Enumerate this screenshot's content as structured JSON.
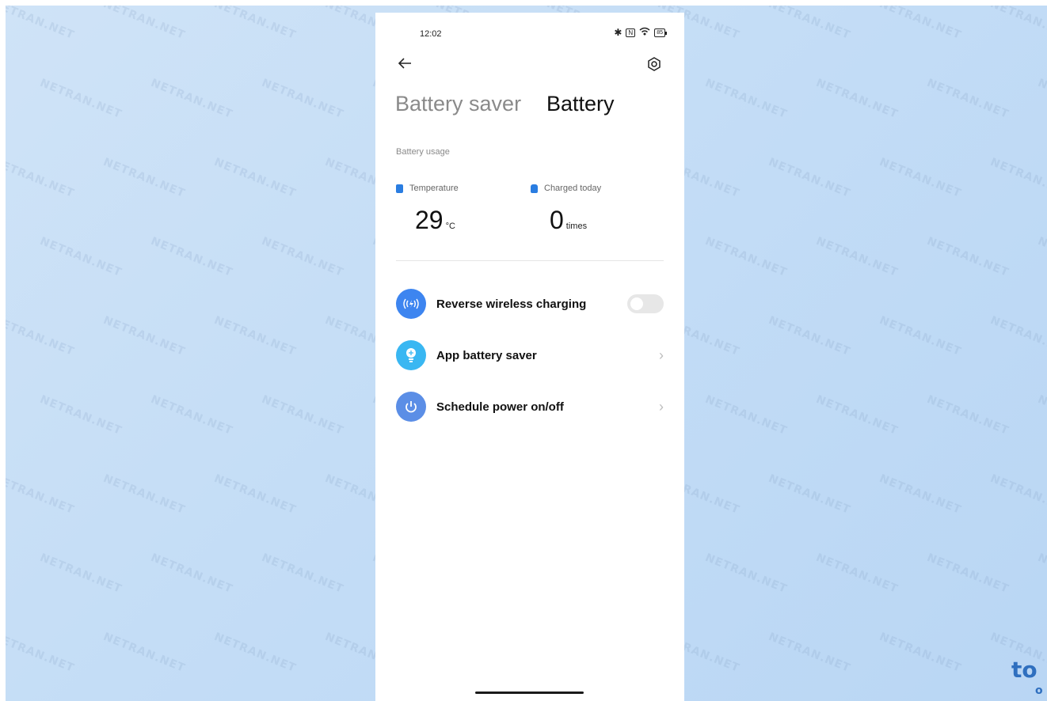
{
  "status_bar": {
    "time": "12:02",
    "icons": [
      "bluetooth-icon",
      "nfc-icon",
      "wifi-icon",
      "battery-icon"
    ],
    "battery_level": "85"
  },
  "header": {
    "tabs": [
      {
        "label": "Battery saver",
        "active": false
      },
      {
        "label": "Battery",
        "active": true
      }
    ]
  },
  "battery_usage": {
    "section_label": "Battery usage",
    "temperature": {
      "label": "Temperature",
      "value": "29",
      "unit": "°C"
    },
    "charged_today": {
      "label": "Charged today",
      "value": "0",
      "unit": "times"
    }
  },
  "settings": [
    {
      "label": "Reverse wireless charging",
      "icon": "wireless-charging-icon",
      "control": "toggle",
      "enabled": false,
      "icon_color": "#3d85f0"
    },
    {
      "label": "App battery saver",
      "icon": "battery-saver-bulb-icon",
      "control": "chevron",
      "icon_color": "#39b7f2"
    },
    {
      "label": "Schedule power on/off",
      "icon": "power-icon",
      "control": "chevron",
      "icon_color": "#5b8ee6"
    }
  ],
  "colors": {
    "background": "#c4ddf6",
    "accent": "#2a7de1",
    "brand_logo": "#2f6fbf"
  },
  "watermark": {
    "text": "NETRAN.NET"
  },
  "corner_logo": {
    "line1": "to",
    "line2": "o"
  }
}
